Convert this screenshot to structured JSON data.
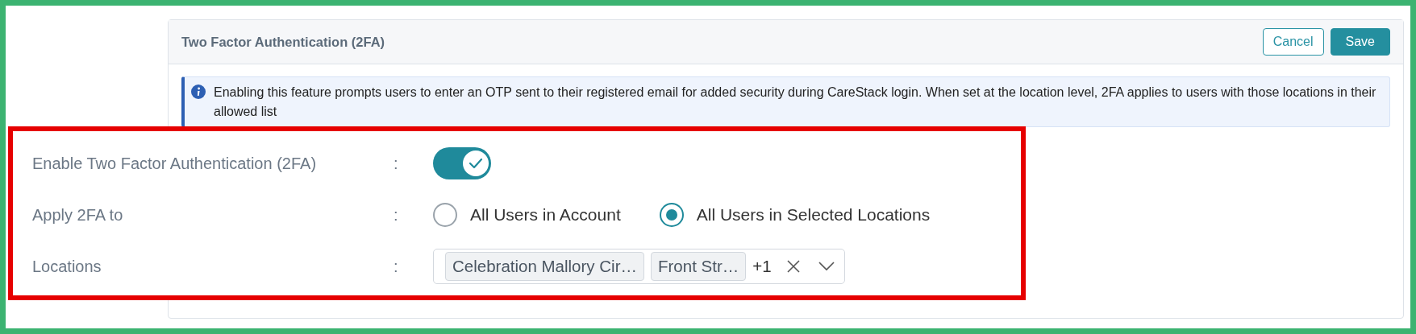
{
  "header": {
    "title": "Two Factor Authentication (2FA)",
    "buttons": [
      {
        "label": "Cancel",
        "kind": "outline"
      },
      {
        "label": "Save",
        "kind": "primary"
      }
    ]
  },
  "info": {
    "text": "Enabling this feature prompts users to enter an OTP sent to their registered email for added security during CareStack login. When set at the location level, 2FA applies to users with those locations in their allowed list"
  },
  "form": {
    "rows": [
      {
        "label": "Enable Two Factor Authentication (2FA)",
        "separator": ":",
        "kind": "toggle",
        "on": true
      },
      {
        "label": "Apply 2FA to",
        "separator": ":",
        "kind": "radio",
        "options": [
          {
            "label": "All Users in Account",
            "selected": false
          },
          {
            "label": "All Users in Selected Locations",
            "selected": true
          }
        ]
      },
      {
        "label": "Locations",
        "separator": ":",
        "kind": "multiselect",
        "tags": [
          "Celebration Mallory Cir…",
          "Front Str…"
        ],
        "more": "+1"
      }
    ]
  }
}
